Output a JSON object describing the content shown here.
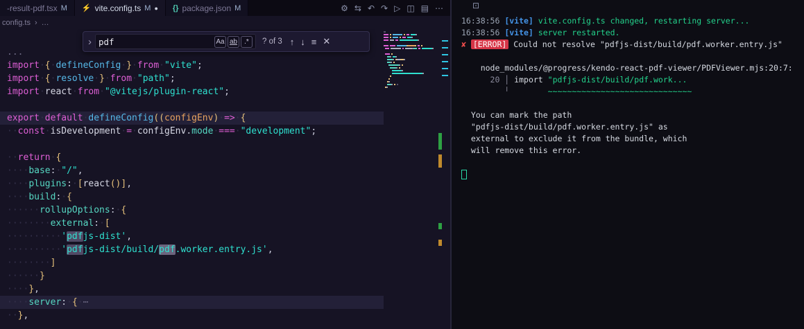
{
  "theme": {
    "editor_bg": "#161324",
    "terminal_bg": "#0d0d14",
    "keyword_pink": "#de5fd5",
    "string_cyan": "#2fe0cf",
    "brace_yellow": "#e5c07b",
    "error_red": "#d63547",
    "success_green": "#23d18b",
    "vite_blue": "#4493e6",
    "match_highlight": "#514a66"
  },
  "tabs": [
    {
      "name": "-result-pdf.tsx",
      "badge": "M",
      "icon_glyph": "",
      "dirty_dot": ""
    },
    {
      "name": "vite.config.ts",
      "badge": "M",
      "icon_glyph": "⚡",
      "dirty_dot": "●"
    },
    {
      "name": "package.json",
      "badge": "M",
      "icon_glyph": "{}",
      "dirty_dot": ""
    }
  ],
  "editor_actions": [
    {
      "name": "settings-gear-icon",
      "glyph": "⚙"
    },
    {
      "name": "compare-changes-icon",
      "glyph": "⇆"
    },
    {
      "name": "nav-back-icon",
      "glyph": "↶"
    },
    {
      "name": "nav-forward-icon",
      "glyph": "↷"
    },
    {
      "name": "run-icon",
      "glyph": "▷"
    },
    {
      "name": "split-editor-icon",
      "glyph": "◫"
    },
    {
      "name": "layout-icon",
      "glyph": "▤"
    },
    {
      "name": "more-actions-icon",
      "glyph": "⋯"
    }
  ],
  "breadcrumb": {
    "file": "config.ts",
    "sep": "›",
    "more": "…"
  },
  "find": {
    "collapse_glyph": "›",
    "query": "pdf",
    "case_label": "Aa",
    "word_label": "ab",
    "regex_label": ".*",
    "results": "? of 3",
    "prev_glyph": "↑",
    "next_glyph": "↓",
    "selection_glyph": "≡",
    "close_glyph": "✕"
  },
  "editor": {
    "lines": [
      {
        "t": [
          [
            "dim",
            "..."
          ]
        ]
      },
      {
        "t": [
          [
            "kw",
            "import"
          ],
          [
            "ws",
            "·"
          ],
          [
            "punc",
            "{"
          ],
          [
            "ws",
            "·"
          ],
          [
            "fn",
            "defineConfig"
          ],
          [
            "ws",
            "·"
          ],
          [
            "punc",
            "}"
          ],
          [
            "ws",
            "·"
          ],
          [
            "kw",
            "from"
          ],
          [
            "ws",
            "·"
          ],
          [
            "str",
            "\"vite\""
          ],
          [
            "plain",
            ";"
          ]
        ]
      },
      {
        "t": [
          [
            "kw",
            "import"
          ],
          [
            "ws",
            "·"
          ],
          [
            "punc",
            "{"
          ],
          [
            "ws",
            "·"
          ],
          [
            "fn",
            "resolve"
          ],
          [
            "ws",
            "·"
          ],
          [
            "punc",
            "}"
          ],
          [
            "ws",
            "·"
          ],
          [
            "kw",
            "from"
          ],
          [
            "ws",
            "·"
          ],
          [
            "str",
            "\"path\""
          ],
          [
            "plain",
            ";"
          ]
        ]
      },
      {
        "t": [
          [
            "kw",
            "import"
          ],
          [
            "ws",
            "·"
          ],
          [
            "var",
            "react"
          ],
          [
            "ws",
            "·"
          ],
          [
            "kw",
            "from"
          ],
          [
            "ws",
            "·"
          ],
          [
            "str",
            "\"@vitejs/plugin-react\""
          ],
          [
            "plain",
            ";"
          ]
        ]
      },
      {
        "t": []
      },
      {
        "hl": true,
        "t": [
          [
            "kw",
            "export"
          ],
          [
            "ws",
            "·"
          ],
          [
            "kw",
            "default"
          ],
          [
            "ws",
            "·"
          ],
          [
            "fn",
            "defineConfig"
          ],
          [
            "punc",
            "(("
          ],
          [
            "param",
            "configEnv"
          ],
          [
            "punc",
            ")"
          ],
          [
            "ws",
            "·"
          ],
          [
            "op",
            "=>"
          ],
          [
            "ws",
            "·"
          ],
          [
            "punc",
            "{"
          ]
        ]
      },
      {
        "t": [
          [
            "ws",
            "··"
          ],
          [
            "kw",
            "const"
          ],
          [
            "ws",
            "·"
          ],
          [
            "var",
            "isDevelopment"
          ],
          [
            "ws",
            "·"
          ],
          [
            "op",
            "="
          ],
          [
            "ws",
            "·"
          ],
          [
            "var",
            "configEnv"
          ],
          [
            "plain",
            "."
          ],
          [
            "prop",
            "mode"
          ],
          [
            "ws",
            "·"
          ],
          [
            "op",
            "==="
          ],
          [
            "ws",
            "·"
          ],
          [
            "str",
            "\"development\""
          ],
          [
            "plain",
            ";"
          ]
        ]
      },
      {
        "t": []
      },
      {
        "t": [
          [
            "ws",
            "··"
          ],
          [
            "kw",
            "return"
          ],
          [
            "ws",
            "·"
          ],
          [
            "punc",
            "{"
          ]
        ]
      },
      {
        "t": [
          [
            "ws",
            "····"
          ],
          [
            "prop",
            "base"
          ],
          [
            "plain",
            ":"
          ],
          [
            "ws",
            "·"
          ],
          [
            "str",
            "\"/\""
          ],
          [
            "plain",
            ","
          ]
        ]
      },
      {
        "t": [
          [
            "ws",
            "····"
          ],
          [
            "prop",
            "plugins"
          ],
          [
            "plain",
            ":"
          ],
          [
            "ws",
            "·"
          ],
          [
            "punc",
            "["
          ],
          [
            "var",
            "react"
          ],
          [
            "punc",
            "()"
          ],
          [
            "punc",
            "]"
          ],
          [
            "plain",
            ","
          ]
        ]
      },
      {
        "t": [
          [
            "ws",
            "····"
          ],
          [
            "prop",
            "build"
          ],
          [
            "plain",
            ":"
          ],
          [
            "ws",
            "·"
          ],
          [
            "punc",
            "{"
          ]
        ]
      },
      {
        "t": [
          [
            "ws",
            "······"
          ],
          [
            "prop",
            "rollupOptions"
          ],
          [
            "plain",
            ":"
          ],
          [
            "ws",
            "·"
          ],
          [
            "punc",
            "{"
          ]
        ]
      },
      {
        "t": [
          [
            "ws",
            "········"
          ],
          [
            "prop",
            "external"
          ],
          [
            "plain",
            ":"
          ],
          [
            "ws",
            "·"
          ],
          [
            "punc",
            "["
          ]
        ]
      },
      {
        "t": [
          [
            "ws",
            "··········"
          ],
          [
            "str",
            "'"
          ],
          [
            "str match",
            "pdf"
          ],
          [
            "str",
            "js-dist'"
          ],
          [
            "plain",
            ","
          ]
        ]
      },
      {
        "t": [
          [
            "ws",
            "··········"
          ],
          [
            "str",
            "'"
          ],
          [
            "str match",
            "pdf"
          ],
          [
            "str",
            "js-dist/build/"
          ],
          [
            "str match-cur",
            "pdf"
          ],
          [
            "str",
            ".worker.entry.js'"
          ],
          [
            "plain",
            ","
          ]
        ]
      },
      {
        "t": [
          [
            "ws",
            "········"
          ],
          [
            "punc",
            "]"
          ]
        ]
      },
      {
        "t": [
          [
            "ws",
            "······"
          ],
          [
            "punc",
            "}"
          ]
        ]
      },
      {
        "t": [
          [
            "ws",
            "····"
          ],
          [
            "punc",
            "}"
          ],
          [
            "plain",
            ","
          ]
        ]
      },
      {
        "hl": true,
        "t": [
          [
            "ws",
            "····"
          ],
          [
            "prop",
            "server"
          ],
          [
            "plain",
            ":"
          ],
          [
            "ws",
            "·"
          ],
          [
            "punc",
            "{"
          ],
          [
            "ws",
            "·"
          ],
          [
            "dim",
            "⋯"
          ]
        ]
      },
      {
        "t": [
          [
            "ws",
            "··"
          ],
          [
            "punc",
            "}"
          ],
          [
            "plain",
            ","
          ]
        ]
      }
    ]
  },
  "terminal": {
    "icon_glyph": "⊡",
    "lines": [
      {
        "t": [
          [
            "t-time",
            "16:38:56 "
          ],
          [
            "t-vite",
            "[vite]"
          ],
          [
            "t-green",
            " vite.config.ts changed, restarting server..."
          ]
        ]
      },
      {
        "t": [
          [
            "t-time",
            "16:38:56 "
          ],
          [
            "t-vite",
            "[vite]"
          ],
          [
            "t-green",
            " server restarted."
          ]
        ]
      },
      {
        "t": [
          [
            "t-x",
            "✘ "
          ],
          [
            "t-errbadge",
            "[ERROR]"
          ],
          [
            "t-plain",
            " Could not resolve \"pdfjs-dist/build/pdf.worker.entry.js\""
          ]
        ]
      },
      {
        "t": []
      },
      {
        "t": [
          [
            "t-plain",
            "    node_modules/@progress/kendo-react-pdf-viewer/PDFViewer.mjs:20:7:"
          ]
        ]
      },
      {
        "t": [
          [
            "t-dim",
            "      20 │ "
          ],
          [
            "t-plain",
            "import "
          ],
          [
            "t-green",
            "\"pdfjs-dist/build/pdf.work..."
          ]
        ]
      },
      {
        "t": [
          [
            "t-dim",
            "         ╵  "
          ],
          [
            "t-green",
            "      ~~~~~~~~~~~~~~~~~~~~~~~~~~~~~~"
          ]
        ]
      },
      {
        "t": []
      },
      {
        "t": [
          [
            "t-plain",
            "  You can mark the path"
          ]
        ]
      },
      {
        "t": [
          [
            "t-plain",
            "  \"pdfjs-dist/build/pdf.worker.entry.js\" as"
          ]
        ]
      },
      {
        "t": [
          [
            "t-plain",
            "  external to exclude it from the bundle, which"
          ]
        ]
      },
      {
        "t": [
          [
            "t-plain",
            "  will remove this error."
          ]
        ]
      },
      {
        "t": []
      },
      {
        "t": [
          [
            "t-cursor",
            ""
          ]
        ]
      }
    ]
  }
}
